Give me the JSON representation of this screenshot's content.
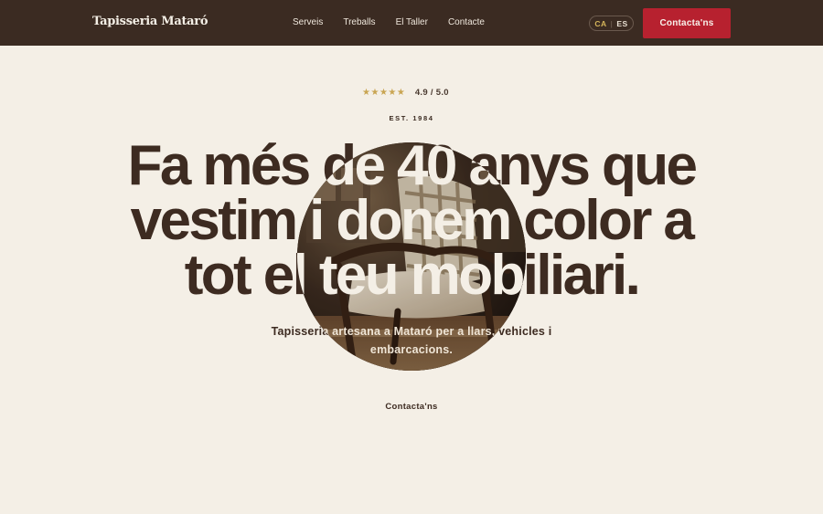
{
  "header": {
    "brand": "Tapisseria Mataró",
    "nav": [
      "Serveis",
      "Treballs",
      "El Taller",
      "Contacte"
    ],
    "lang": {
      "active": "CA",
      "separator": "|",
      "other": "ES"
    },
    "cta_label": "Contacta'ns"
  },
  "hero": {
    "rating": {
      "stars": 5,
      "score": "4.9 / 5.0"
    },
    "est": "EST. 1984",
    "headline_lines": [
      "Fa més de 40 anys que",
      "vestim i donem color a",
      "tot el teu mobiliari."
    ],
    "subtitle": "Tapisseria artesana a Mataró per a llars, vehicles i embarcacions.",
    "contact_link": "Contacta'ns"
  },
  "colors": {
    "header_bg": "#3b2b22",
    "page_bg": "#f4efe6",
    "accent_red": "#b7212f",
    "star_gold": "#c9a552",
    "text_dark": "#3d2b21"
  },
  "icons": {
    "rating": "star-icon",
    "hero_image": "upholstered-armchair-photo"
  }
}
